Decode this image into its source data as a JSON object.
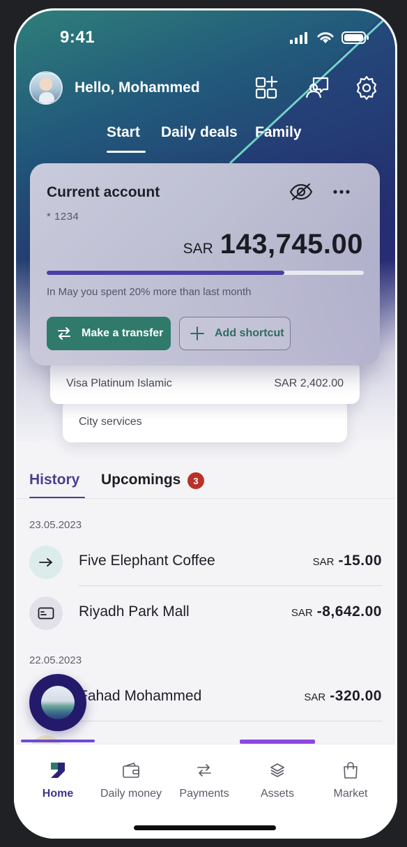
{
  "status_bar": {
    "time": "9:41"
  },
  "header": {
    "greeting": "Hello, Mohammed"
  },
  "tabs": [
    {
      "label": "Start",
      "active": true
    },
    {
      "label": "Daily deals",
      "active": false
    },
    {
      "label": "Family",
      "active": false
    }
  ],
  "account_card": {
    "title": "Current account",
    "number": "* 1234",
    "currency": "SAR",
    "balance": "143,745.00",
    "spend_progress": 0.75,
    "note": "In May you spent 20% more than last month",
    "transfer_label": "Make a transfer",
    "shortcut_label": "Add shortcut"
  },
  "stacked_cards": [
    {
      "label": "Visa Platinum Islamic",
      "amount": "SAR 2,402.00"
    },
    {
      "label": "City services"
    }
  ],
  "history": {
    "active_tab": "History",
    "other_tab": "Upcomings",
    "upcoming_count": "3",
    "groups": [
      {
        "date": "23.05.2023",
        "items": [
          {
            "name": "Five Elephant Coffee",
            "currency": "SAR",
            "amount": "-15.00",
            "icon": "arrow-right-icon"
          },
          {
            "name": "Riyadh Park Mall",
            "currency": "SAR",
            "amount": "-8,642.00",
            "icon": "card-icon"
          }
        ]
      },
      {
        "date": "22.05.2023",
        "items": [
          {
            "name": "Fahad Mohammed",
            "currency": "SAR",
            "amount": "-320.00",
            "icon": "person-icon"
          }
        ]
      }
    ]
  },
  "bottom_nav": [
    {
      "label": "Home",
      "icon": "home-icon",
      "active": true
    },
    {
      "label": "Daily money",
      "icon": "wallet-icon",
      "active": false
    },
    {
      "label": "Payments",
      "icon": "transfer-icon",
      "active": false
    },
    {
      "label": "Assets",
      "icon": "layers-icon",
      "active": false
    },
    {
      "label": "Market",
      "icon": "bag-icon",
      "active": false
    }
  ],
  "colors": {
    "accent": "#2f7a6a",
    "brand_purple": "#4b3f8c",
    "badge": "#b8322a"
  }
}
